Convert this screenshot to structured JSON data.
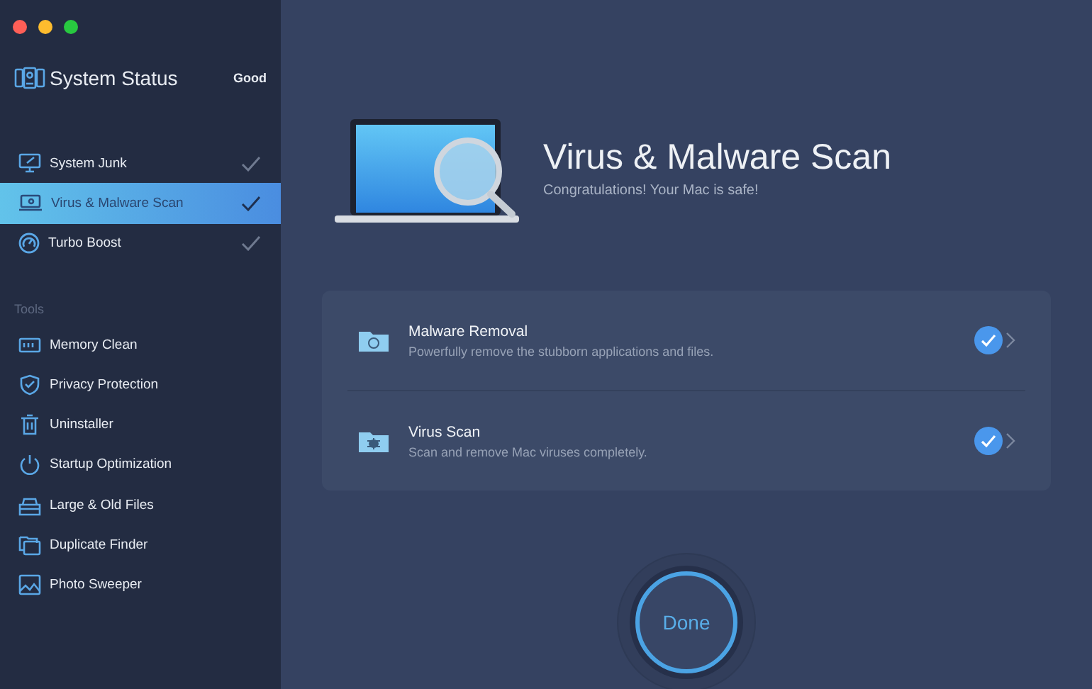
{
  "sidebar": {
    "status": {
      "label": "System Status",
      "value": "Good"
    },
    "scan_items": [
      {
        "label": "System Junk",
        "selected": false,
        "checked": true
      },
      {
        "label": "Virus & Malware Scan",
        "selected": true,
        "checked": true
      },
      {
        "label": "Turbo Boost",
        "selected": false,
        "checked": true
      }
    ],
    "tools_heading": "Tools",
    "tools": [
      {
        "label": "Memory Clean"
      },
      {
        "label": "Privacy Protection"
      },
      {
        "label": "Uninstaller"
      },
      {
        "label": "Startup Optimization"
      },
      {
        "label": "Large & Old Files"
      },
      {
        "label": "Duplicate Finder"
      },
      {
        "label": "Photo Sweeper"
      }
    ]
  },
  "main": {
    "title": "Virus & Malware Scan",
    "subtitle": "Congratulations! Your Mac is safe!",
    "results": [
      {
        "title": "Malware Removal",
        "description": "Powerfully remove the stubborn applications and files.",
        "checked": true
      },
      {
        "title": "Virus Scan",
        "description": "Scan and remove Mac viruses completely.",
        "checked": true
      }
    ],
    "done_button": "Done"
  }
}
